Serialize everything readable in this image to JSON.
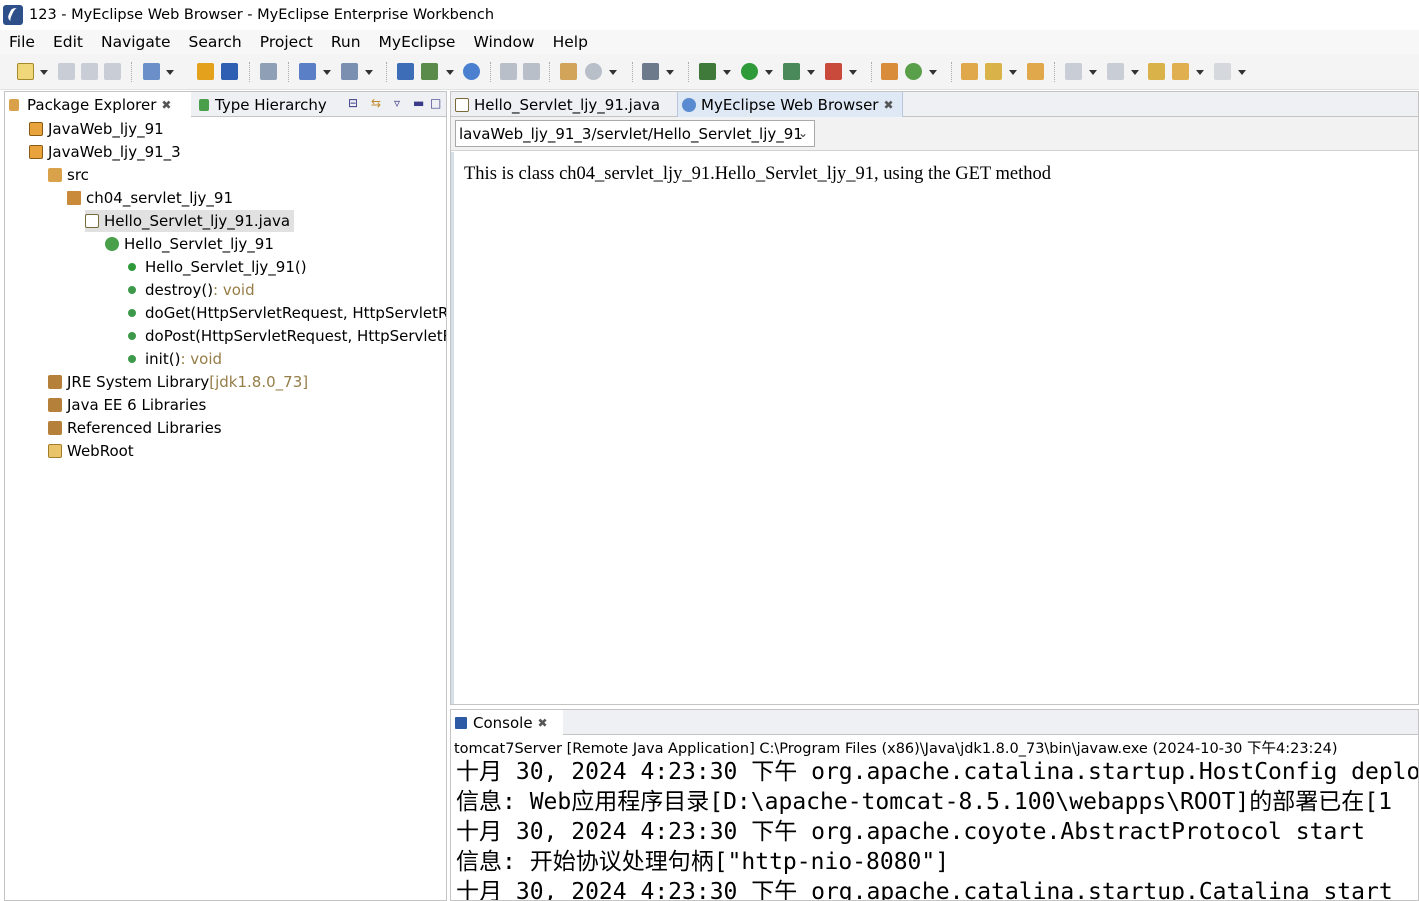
{
  "window": {
    "title": "123 - MyEclipse Web Browser - MyEclipse Enterprise Workbench"
  },
  "menu": [
    "File",
    "Edit",
    "Navigate",
    "Search",
    "Project",
    "Run",
    "MyEclipse",
    "Window",
    "Help"
  ],
  "left_panel": {
    "tabs": [
      {
        "label": "Package Explorer",
        "icon": "package-explorer-icon",
        "close": "✖"
      },
      {
        "label": "Type Hierarchy",
        "icon": "type-hierarchy-icon"
      }
    ],
    "tree": [
      {
        "label": "JavaWeb_ljy_91",
        "icon": "project-icon"
      },
      {
        "label": "JavaWeb_ljy_91_3",
        "icon": "project-icon"
      },
      {
        "label": "src",
        "icon": "source-folder-icon"
      },
      {
        "label": "ch04_servlet_ljy_91",
        "icon": "package-icon"
      },
      {
        "label": "Hello_Servlet_ljy_91.java",
        "icon": "java-file-icon",
        "selected": true
      },
      {
        "label": "Hello_Servlet_ljy_91",
        "icon": "class-icon"
      },
      {
        "label": "Hello_Servlet_ljy_91()",
        "icon": "constructor-icon"
      },
      {
        "label": "destroy()",
        "suffix": " : void",
        "icon": "method-icon"
      },
      {
        "label": "doGet(HttpServletRequest, HttpServletR",
        "icon": "method-icon"
      },
      {
        "label": "doPost(HttpServletRequest, HttpServletR",
        "icon": "method-icon"
      },
      {
        "label": "init()",
        "suffix": " : void",
        "icon": "method-icon"
      },
      {
        "label": "JRE System Library",
        "suffix": " [jdk1.8.0_73]",
        "icon": "library-icon"
      },
      {
        "label": "Java EE 6 Libraries",
        "icon": "library-icon"
      },
      {
        "label": "Referenced Libraries",
        "icon": "library-icon"
      },
      {
        "label": "WebRoot",
        "icon": "folder-icon"
      }
    ]
  },
  "editor": {
    "tabs": [
      {
        "label": "Hello_Servlet_ljy_91.java",
        "icon": "java-file-icon"
      },
      {
        "label": "MyEclipse Web Browser",
        "icon": "globe-icon",
        "active": true,
        "close": "✖"
      }
    ],
    "url": "lavaWeb_ljy_91_3/servlet/Hello_Servlet_ljy_91",
    "page_text": "This is class ch04_servlet_ljy_91.Hello_Servlet_ljy_91, using the GET method"
  },
  "console": {
    "tab_label": "Console",
    "close": "✖",
    "description": "tomcat7Server [Remote Java Application] C:\\Program Files (x86)\\Java\\jdk1.8.0_73\\bin\\javaw.exe (2024-10-30 下午4:23:24)",
    "lines": [
      "十月 30, 2024 4:23:30 下午 org.apache.catalina.startup.HostConfig deplo",
      "信息: Web应用程序目录[D:\\apache-tomcat-8.5.100\\webapps\\ROOT]的部署已在[1",
      "十月 30, 2024 4:23:30 下午 org.apache.coyote.AbstractProtocol start",
      "信息: 开始协议处理句柄[\"http-nio-8080\"]",
      "十月 30, 2024 4:23:30 下午 org.apache.catalina.startup.Catalina start"
    ]
  },
  "colors": {
    "accent": "#dfe8f5",
    "dim_text": "#957d47",
    "panel_border": "#c4c4c4"
  }
}
